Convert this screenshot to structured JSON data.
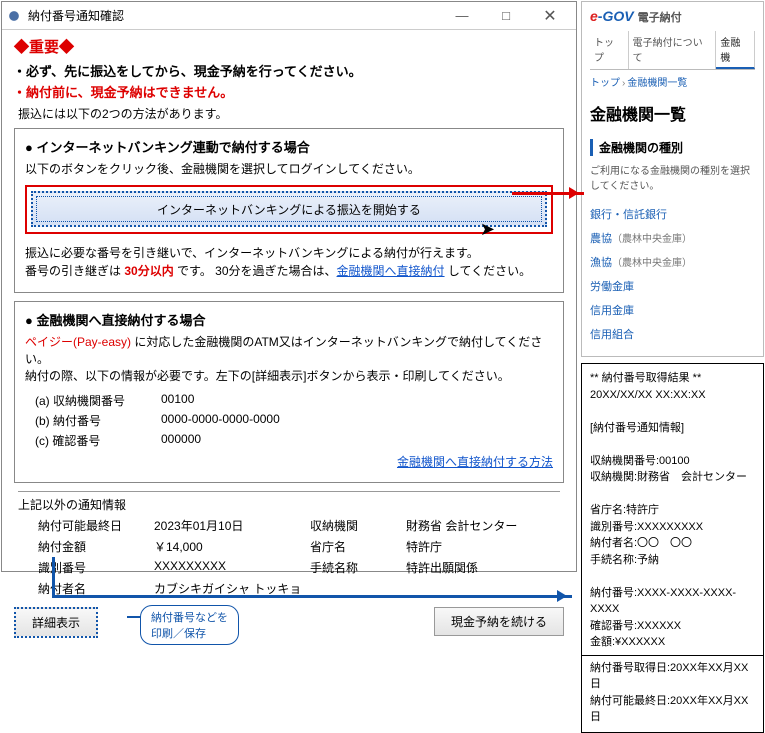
{
  "window": {
    "title": "納付番号通知確認",
    "important": "◆重要◆",
    "notes": [
      "必ず、先に振込をしてから、現金予納を行ってください。",
      "納付前に、現金予納はできません。"
    ],
    "subnote": "振込には以下の2つの方法があります。",
    "panel1": {
      "title": "● インターネットバンキング連動で納付する場合",
      "desc": "以下のボタンをクリック後、金融機関を選択してログインしてください。",
      "button": "インターネットバンキングによる振込を開始する",
      "foot1": "振込に必要な番号を引き継いで、インターネットバンキングによる納付が行えます。",
      "foot2a": "番号の引き継ぎは ",
      "foot2b": "30分以内",
      "foot2c": " です。 30分を過ぎた場合は、",
      "foot2link": "金融機関へ直接納付",
      "foot2d": " してください。"
    },
    "panel2": {
      "title": "● 金融機関へ直接納付する場合",
      "pe": "ペイジー(Pay-easy)",
      "desc": " に対応した金融機関のATM又はインターネットバンキングで納付してください。",
      "desc2": "納付の際、以下の情報が必要です。左下の[詳細表示]ボタンから表示・印刷してください。",
      "rows": [
        {
          "label": "(a) 収納機関番号",
          "value": "00100"
        },
        {
          "label": "(b) 納付番号",
          "value": "0000-0000-0000-0000"
        },
        {
          "label": "(c) 確認番号",
          "value": "000000"
        }
      ],
      "link": "金融機関へ直接納付する方法"
    },
    "other": {
      "title": "上記以外の通知情報",
      "items": [
        [
          "納付可能最終日",
          "2023年01月10日",
          "収納機関",
          "財務省 会計センター"
        ],
        [
          "納付金額",
          "￥14,000",
          "省庁名",
          "特許庁"
        ],
        [
          "識別番号",
          "XXXXXXXXX",
          "手続名称",
          "特許出願関係"
        ],
        [
          "納付者名",
          "カブシキガイシャ トッキョ",
          "",
          ""
        ]
      ]
    },
    "buttons": {
      "detail": "詳細表示",
      "continue": "現金予納を続ける"
    },
    "callout": "納付番号などを\n印刷／保存"
  },
  "egov": {
    "brand_jp": "電子納付",
    "tabs": [
      "トップ",
      "電子納付について",
      "金融機"
    ],
    "crumb1": "トップ",
    "crumb2": "金融機関一覧",
    "h1": "金融機関一覧",
    "h2": "金融機関の種別",
    "note": "ご利用になる金融機関の種別を選択してください。",
    "cats": [
      {
        "t": "銀行・信託銀行"
      },
      {
        "t": "農協",
        "s": "（農林中央金庫）"
      },
      {
        "t": "漁協",
        "s": "（農林中央金庫）"
      },
      {
        "t": "労働金庫"
      },
      {
        "t": "信用金庫"
      },
      {
        "t": "信用組合"
      }
    ]
  },
  "receipt": {
    "head": "** 納付番号取得結果 **",
    "date": "20XX/XX/XX XX:XX:XX",
    "sect": "[納付番号通知情報]",
    "l1": "収納機関番号:00100",
    "l2": "収納機関:財務省　会計センター",
    "l3": "省庁名:特許庁",
    "l4": "識別番号:XXXXXXXXX",
    "l5": "納付者名:〇〇　〇〇",
    "l6": "手続名称:予納",
    "l7": "納付番号:XXXX-XXXX-XXXX-XXXX",
    "l8": "確認番号:XXXXXX",
    "l9": "金額:¥XXXXXX",
    "l10": "納付番号取得日:20XX年XX月XX日",
    "l11": "納付可能最終日:20XX年XX月XX日"
  }
}
